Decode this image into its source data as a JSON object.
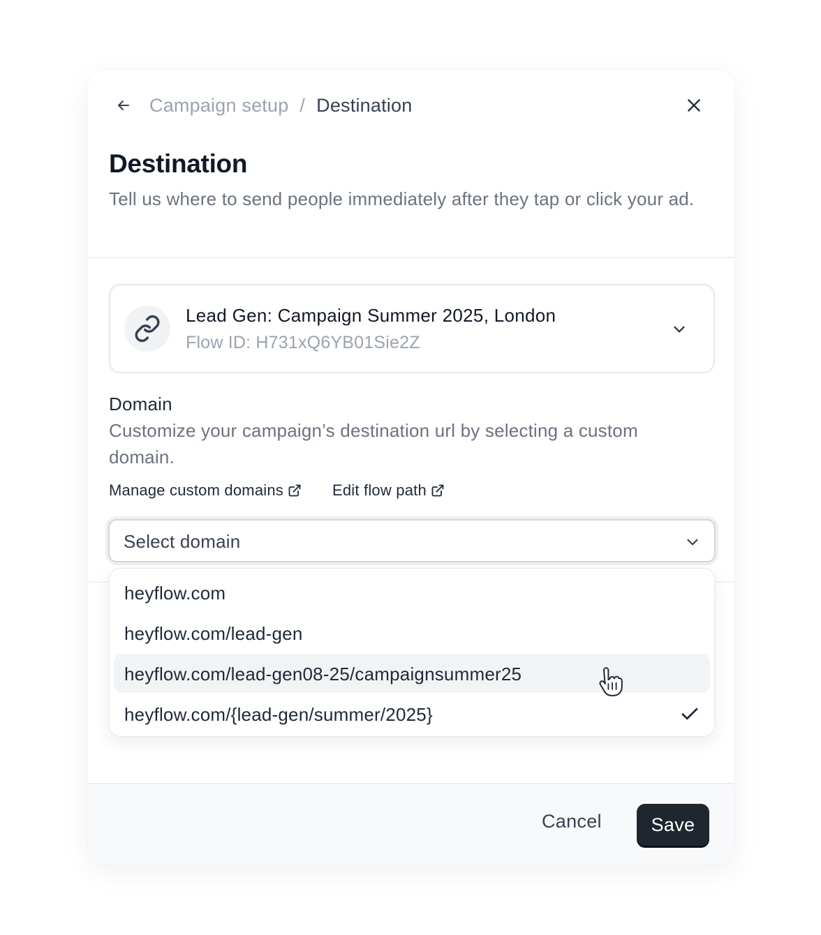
{
  "header": {
    "back_icon": "arrow-left-icon",
    "breadcrumb": {
      "parent": "Campaign setup",
      "separator": "/",
      "current": "Destination"
    },
    "close_icon": "close-icon"
  },
  "title": "Destination",
  "subtitle": "Tell us where to send people immediately after they tap or click your ad.",
  "flow": {
    "icon": "link-icon",
    "name": "Lead Gen: Campaign Summer 2025, London",
    "id_text": "Flow ID: H731xQ6YB01Sie2Z"
  },
  "domain": {
    "label": "Domain",
    "description": "Customize your campaign’s destination url by selecting a custom domain.",
    "links": [
      {
        "label": "Manage custom domains",
        "icon": "external-link-icon"
      },
      {
        "label": "Edit flow path",
        "icon": "external-link-icon"
      }
    ],
    "select": {
      "placeholder": "Select domain",
      "icon": "chevron-down-icon"
    },
    "options": [
      {
        "label": "heyflow.com",
        "hovered": false,
        "selected": false
      },
      {
        "label": "heyflow.com/lead-gen",
        "hovered": false,
        "selected": false
      },
      {
        "label": "heyflow.com/lead-gen08-25/campaignsummer25",
        "hovered": true,
        "selected": false
      },
      {
        "label": "heyflow.com/{lead-gen/summer/2025}",
        "hovered": false,
        "selected": true
      }
    ]
  },
  "footer": {
    "cancel_label": "Cancel",
    "save_label": "Save"
  },
  "colors": {
    "primary_button": "#1f2630",
    "muted_text": "#6b7280",
    "border": "#e5e7eb",
    "hover_bg": "#f2f3f5"
  }
}
